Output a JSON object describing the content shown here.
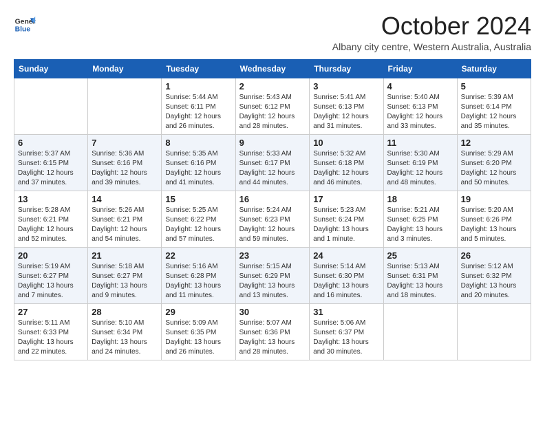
{
  "logo": {
    "line1": "General",
    "line2": "Blue"
  },
  "title": "October 2024",
  "location": "Albany city centre, Western Australia, Australia",
  "weekdays": [
    "Sunday",
    "Monday",
    "Tuesday",
    "Wednesday",
    "Thursday",
    "Friday",
    "Saturday"
  ],
  "weeks": [
    [
      {
        "day": "",
        "info": ""
      },
      {
        "day": "",
        "info": ""
      },
      {
        "day": "1",
        "info": "Sunrise: 5:44 AM\nSunset: 6:11 PM\nDaylight: 12 hours and 26 minutes."
      },
      {
        "day": "2",
        "info": "Sunrise: 5:43 AM\nSunset: 6:12 PM\nDaylight: 12 hours and 28 minutes."
      },
      {
        "day": "3",
        "info": "Sunrise: 5:41 AM\nSunset: 6:13 PM\nDaylight: 12 hours and 31 minutes."
      },
      {
        "day": "4",
        "info": "Sunrise: 5:40 AM\nSunset: 6:13 PM\nDaylight: 12 hours and 33 minutes."
      },
      {
        "day": "5",
        "info": "Sunrise: 5:39 AM\nSunset: 6:14 PM\nDaylight: 12 hours and 35 minutes."
      }
    ],
    [
      {
        "day": "6",
        "info": "Sunrise: 5:37 AM\nSunset: 6:15 PM\nDaylight: 12 hours and 37 minutes."
      },
      {
        "day": "7",
        "info": "Sunrise: 5:36 AM\nSunset: 6:16 PM\nDaylight: 12 hours and 39 minutes."
      },
      {
        "day": "8",
        "info": "Sunrise: 5:35 AM\nSunset: 6:16 PM\nDaylight: 12 hours and 41 minutes."
      },
      {
        "day": "9",
        "info": "Sunrise: 5:33 AM\nSunset: 6:17 PM\nDaylight: 12 hours and 44 minutes."
      },
      {
        "day": "10",
        "info": "Sunrise: 5:32 AM\nSunset: 6:18 PM\nDaylight: 12 hours and 46 minutes."
      },
      {
        "day": "11",
        "info": "Sunrise: 5:30 AM\nSunset: 6:19 PM\nDaylight: 12 hours and 48 minutes."
      },
      {
        "day": "12",
        "info": "Sunrise: 5:29 AM\nSunset: 6:20 PM\nDaylight: 12 hours and 50 minutes."
      }
    ],
    [
      {
        "day": "13",
        "info": "Sunrise: 5:28 AM\nSunset: 6:21 PM\nDaylight: 12 hours and 52 minutes."
      },
      {
        "day": "14",
        "info": "Sunrise: 5:26 AM\nSunset: 6:21 PM\nDaylight: 12 hours and 54 minutes."
      },
      {
        "day": "15",
        "info": "Sunrise: 5:25 AM\nSunset: 6:22 PM\nDaylight: 12 hours and 57 minutes."
      },
      {
        "day": "16",
        "info": "Sunrise: 5:24 AM\nSunset: 6:23 PM\nDaylight: 12 hours and 59 minutes."
      },
      {
        "day": "17",
        "info": "Sunrise: 5:23 AM\nSunset: 6:24 PM\nDaylight: 13 hours and 1 minute."
      },
      {
        "day": "18",
        "info": "Sunrise: 5:21 AM\nSunset: 6:25 PM\nDaylight: 13 hours and 3 minutes."
      },
      {
        "day": "19",
        "info": "Sunrise: 5:20 AM\nSunset: 6:26 PM\nDaylight: 13 hours and 5 minutes."
      }
    ],
    [
      {
        "day": "20",
        "info": "Sunrise: 5:19 AM\nSunset: 6:27 PM\nDaylight: 13 hours and 7 minutes."
      },
      {
        "day": "21",
        "info": "Sunrise: 5:18 AM\nSunset: 6:27 PM\nDaylight: 13 hours and 9 minutes."
      },
      {
        "day": "22",
        "info": "Sunrise: 5:16 AM\nSunset: 6:28 PM\nDaylight: 13 hours and 11 minutes."
      },
      {
        "day": "23",
        "info": "Sunrise: 5:15 AM\nSunset: 6:29 PM\nDaylight: 13 hours and 13 minutes."
      },
      {
        "day": "24",
        "info": "Sunrise: 5:14 AM\nSunset: 6:30 PM\nDaylight: 13 hours and 16 minutes."
      },
      {
        "day": "25",
        "info": "Sunrise: 5:13 AM\nSunset: 6:31 PM\nDaylight: 13 hours and 18 minutes."
      },
      {
        "day": "26",
        "info": "Sunrise: 5:12 AM\nSunset: 6:32 PM\nDaylight: 13 hours and 20 minutes."
      }
    ],
    [
      {
        "day": "27",
        "info": "Sunrise: 5:11 AM\nSunset: 6:33 PM\nDaylight: 13 hours and 22 minutes."
      },
      {
        "day": "28",
        "info": "Sunrise: 5:10 AM\nSunset: 6:34 PM\nDaylight: 13 hours and 24 minutes."
      },
      {
        "day": "29",
        "info": "Sunrise: 5:09 AM\nSunset: 6:35 PM\nDaylight: 13 hours and 26 minutes."
      },
      {
        "day": "30",
        "info": "Sunrise: 5:07 AM\nSunset: 6:36 PM\nDaylight: 13 hours and 28 minutes."
      },
      {
        "day": "31",
        "info": "Sunrise: 5:06 AM\nSunset: 6:37 PM\nDaylight: 13 hours and 30 minutes."
      },
      {
        "day": "",
        "info": ""
      },
      {
        "day": "",
        "info": ""
      }
    ]
  ]
}
